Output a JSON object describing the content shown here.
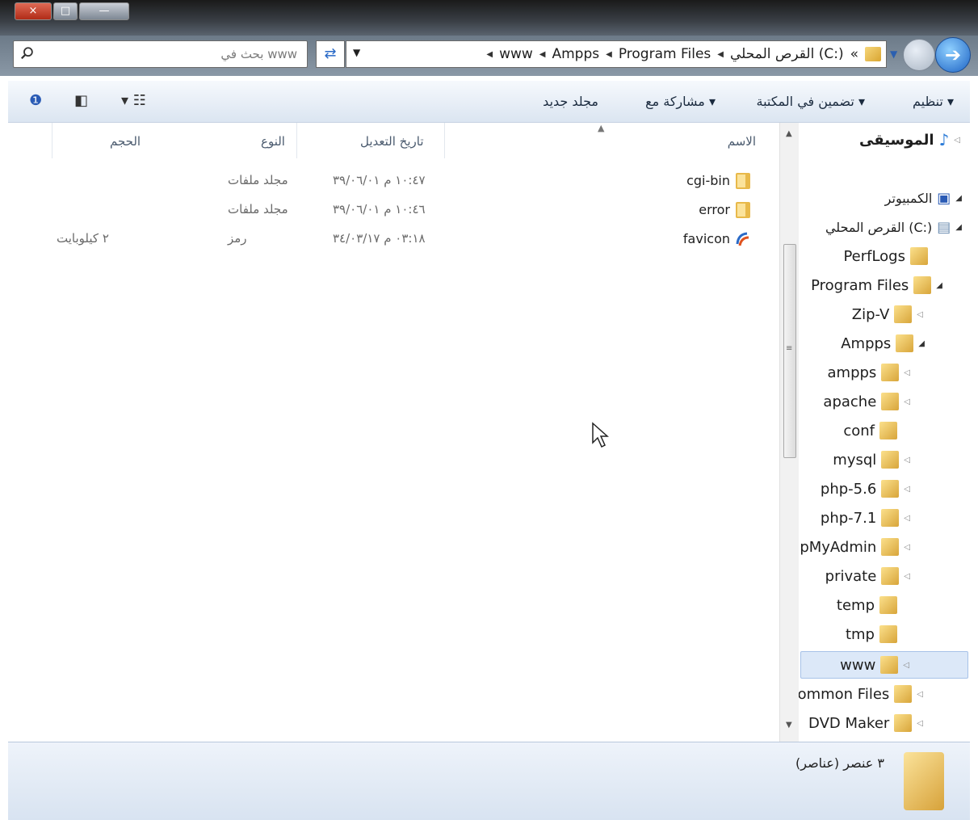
{
  "window_controls": {
    "close": "×",
    "max": "□",
    "min": "—"
  },
  "search": {
    "placeholder": "بحث في www"
  },
  "address": {
    "crumbs": [
      "www",
      "Ampps",
      "Program Files",
      "القرص المحلي (C:)"
    ],
    "overflow": "«"
  },
  "toolbar": {
    "organize": "تنظيم ▾",
    "include_in_library": "تضمين في المكتبة ▾",
    "share_with": "مشاركة مع ▾",
    "new_folder": "مجلد جديد"
  },
  "columns": {
    "name": "الاسم",
    "modified": "تاريخ التعديل",
    "type": "النوع",
    "size": "الحجم"
  },
  "files": [
    {
      "name": "cgi-bin",
      "modified": "١٠:٤٧ م ٣٩/٠٦/٠١",
      "type": "مجلد ملفات",
      "size": "",
      "icon": "folder-icon"
    },
    {
      "name": "error",
      "modified": "١٠:٤٦ م ٣٩/٠٦/٠١",
      "type": "مجلد ملفات",
      "size": "",
      "icon": "folder-icon"
    },
    {
      "name": "favicon",
      "modified": "٠٣:١٨ م ٣٤/٠٣/١٧",
      "type": "رمز",
      "size": "٢ كيلوبايت",
      "icon": "favicon-icon"
    }
  ],
  "tree": [
    {
      "label": "الموسيقى",
      "kind": "music"
    },
    {
      "label": "الكمبيوتر",
      "kind": "computer"
    },
    {
      "label": "القرص المحلي (C:)",
      "kind": "drive"
    },
    {
      "label": "PerfLogs",
      "kind": "folder"
    },
    {
      "label": "Program Files",
      "kind": "folder"
    },
    {
      "label": "Zip-V",
      "kind": "folder"
    },
    {
      "label": "Ampps",
      "kind": "folder"
    },
    {
      "label": "ampps",
      "kind": "folder"
    },
    {
      "label": "apache",
      "kind": "folder"
    },
    {
      "label": "conf",
      "kind": "folder"
    },
    {
      "label": "mysql",
      "kind": "folder"
    },
    {
      "label": "php-5.6",
      "kind": "folder"
    },
    {
      "label": "php-7.1",
      "kind": "folder"
    },
    {
      "label": "pMyAdmin",
      "kind": "folder"
    },
    {
      "label": "private",
      "kind": "folder"
    },
    {
      "label": "temp",
      "kind": "folder"
    },
    {
      "label": "tmp",
      "kind": "folder"
    },
    {
      "label": "www",
      "kind": "folder",
      "selected": true
    },
    {
      "label": "ommon Files",
      "kind": "folder"
    },
    {
      "label": "DVD Maker",
      "kind": "folder"
    }
  ],
  "status": {
    "count_text": "٣ عنصر (عناصر)"
  },
  "colors": {
    "accent": "#1d63c4",
    "folder": "#e8b94a",
    "selection": "#dce8f8"
  }
}
